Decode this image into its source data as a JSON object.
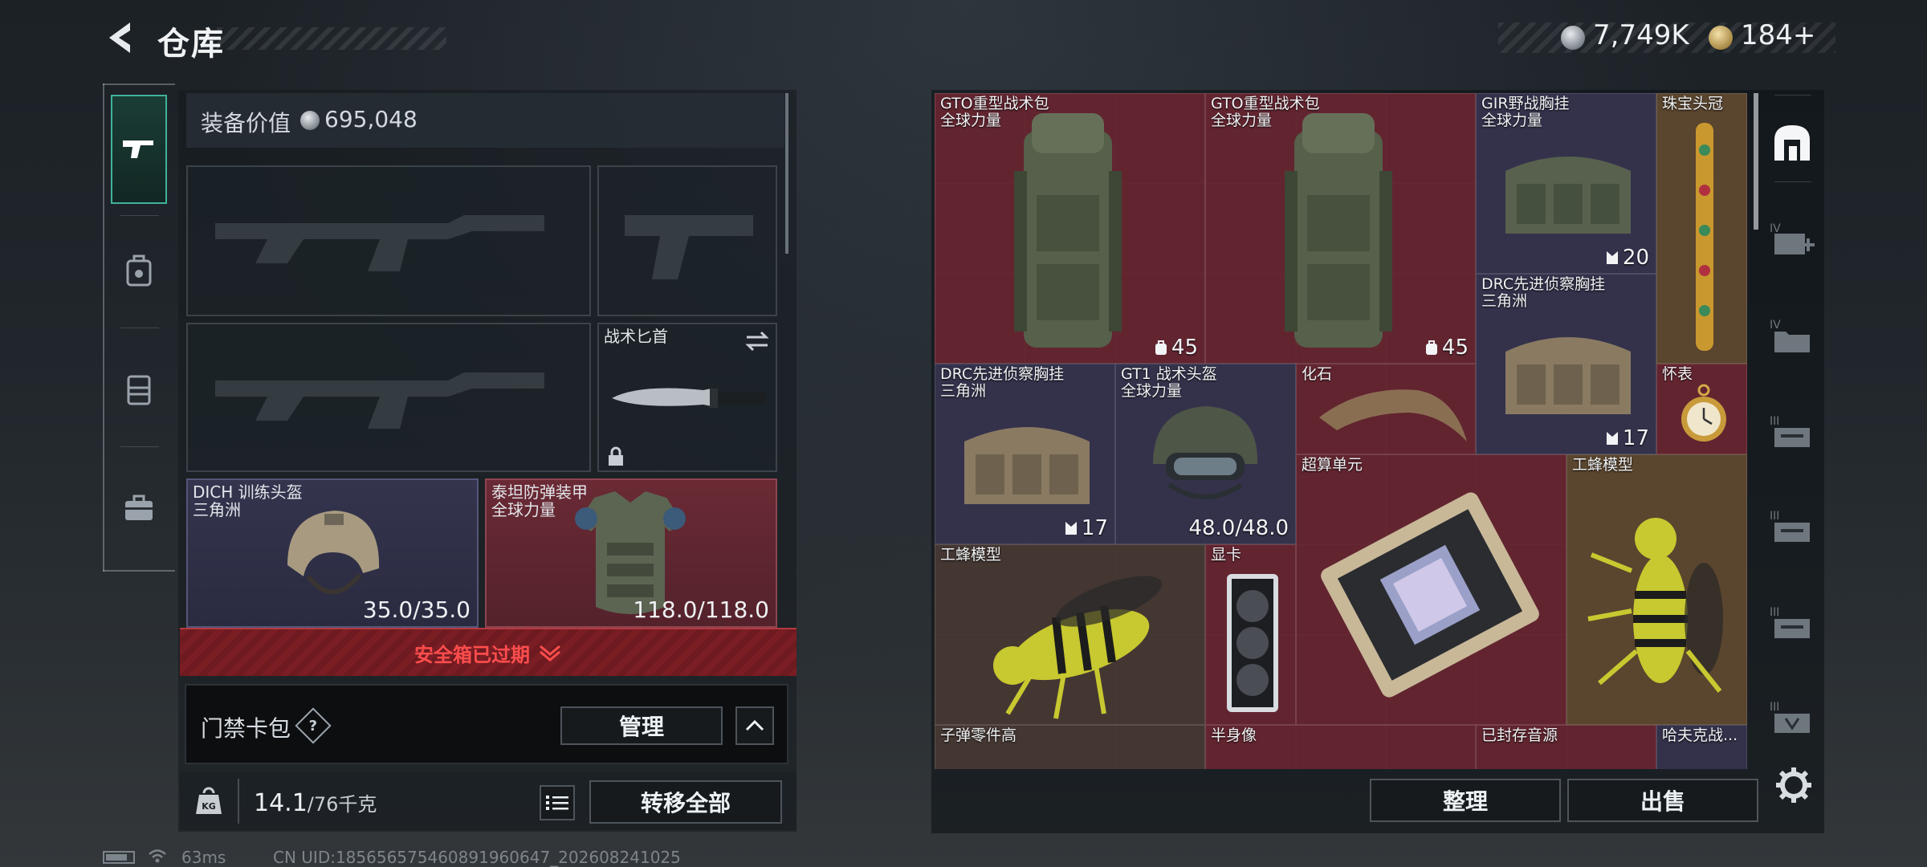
{
  "header": {
    "title": "仓库",
    "currency": {
      "silver": "7,749K",
      "gold": "184+"
    }
  },
  "left_nav": {
    "items": [
      {
        "name": "weapon"
      },
      {
        "name": "backpack"
      },
      {
        "name": "vest"
      },
      {
        "name": "case"
      }
    ]
  },
  "equipment": {
    "value_label": "装备价值",
    "value": "695,048",
    "knife_label": "战术匕首",
    "helmet": {
      "name": "DICH 训练头盔",
      "sub": "三角洲",
      "durability": "35.0/35.0"
    },
    "armor": {
      "name": "泰坦防弹装甲",
      "sub": "全球力量",
      "durability": "118.0/118.0"
    }
  },
  "safe_box": {
    "text": "安全箱已过期"
  },
  "access_card": {
    "label": "门禁卡包",
    "help": "?",
    "manage": "管理"
  },
  "weight": {
    "current": "14.1",
    "max": "/76千克"
  },
  "transfer_all": "转移全部",
  "status": {
    "ping": "63ms",
    "uid": "CN UID:1856565754608919606​47_202608241025"
  },
  "stash": {
    "items": [
      {
        "name": "GTO重型战术包",
        "sub": "全球力量",
        "qty": "45"
      },
      {
        "name": "GTO重型战术包",
        "sub": "全球力量",
        "qty": "45"
      },
      {
        "name": "GIR野战胸挂",
        "sub": "全球力量",
        "qty": "20"
      },
      {
        "name": "珠宝头冠",
        "sub": "",
        "qty": ""
      },
      {
        "name": "DRC先进侦察胸挂",
        "sub": "三角洲",
        "qty": "17"
      },
      {
        "name": "DRC先进侦察胸挂",
        "sub": "三角洲",
        "qty": "17"
      },
      {
        "name": "GT1 战术头盔",
        "sub": "全球力量",
        "qty": "48.0/48.0"
      },
      {
        "name": "化石",
        "sub": "",
        "qty": ""
      },
      {
        "name": "怀表",
        "sub": "",
        "qty": ""
      },
      {
        "name": "超算单元",
        "sub": "",
        "qty": ""
      },
      {
        "name": "工蜂模型",
        "sub": "",
        "qty": ""
      },
      {
        "name": "工蜂模型",
        "sub": "",
        "qty": ""
      },
      {
        "name": "显卡",
        "sub": "",
        "qty": ""
      },
      {
        "name": "子弹零件高",
        "sub": "",
        "qty": ""
      },
      {
        "name": "半身像",
        "sub": "",
        "qty": ""
      },
      {
        "name": "已封存音源",
        "sub": "",
        "qty": ""
      },
      {
        "name": "哈夫克战...",
        "sub": "",
        "qty": ""
      }
    ],
    "sort": "整理",
    "sell": "出售"
  },
  "right_rail": {
    "items": [
      {
        "name": "stash-home"
      },
      {
        "name": "IV"
      },
      {
        "name": "IV"
      },
      {
        "name": "III"
      },
      {
        "name": "III"
      },
      {
        "name": "III"
      },
      {
        "name": "III"
      }
    ]
  },
  "colors": {
    "accent_green": "#3fb29a",
    "rarity_red": "#6e2430",
    "rarity_purple": "#343450",
    "rarity_gold": "#604a2e",
    "warning_red": "#ff4d4d"
  }
}
